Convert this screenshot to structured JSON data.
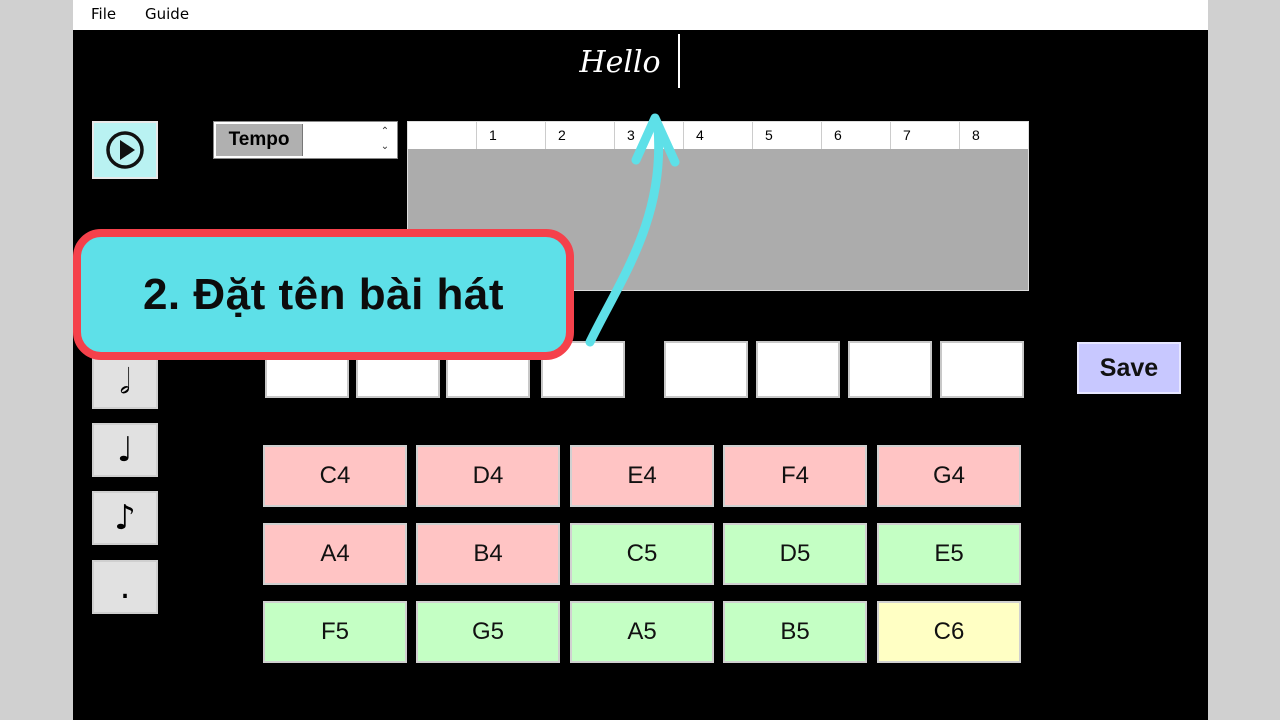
{
  "menu": {
    "file": "File",
    "guide": "Guide"
  },
  "song": {
    "title": "Hello"
  },
  "tempo": {
    "label": "Tempo",
    "value": ""
  },
  "grid": {
    "columns": [
      "1",
      "2",
      "3",
      "4",
      "5",
      "6",
      "7",
      "8"
    ]
  },
  "durations": [
    {
      "icon": "half-note-icon",
      "glyph": "𝅗𝅥"
    },
    {
      "icon": "quarter-note-icon",
      "glyph": "♩"
    },
    {
      "icon": "eighth-note-icon",
      "glyph": "♪"
    },
    {
      "icon": "dot-icon",
      "glyph": "."
    }
  ],
  "save_label": "Save",
  "notes": [
    {
      "label": "C4",
      "color": "#ffc4c4"
    },
    {
      "label": "D4",
      "color": "#ffc4c4"
    },
    {
      "label": "E4",
      "color": "#ffc4c4"
    },
    {
      "label": "F4",
      "color": "#ffc4c4"
    },
    {
      "label": "G4",
      "color": "#ffc4c4"
    },
    {
      "label": "A4",
      "color": "#ffc4c4"
    },
    {
      "label": "B4",
      "color": "#ffc4c4"
    },
    {
      "label": "C5",
      "color": "#c4ffc4"
    },
    {
      "label": "D5",
      "color": "#c4ffc4"
    },
    {
      "label": "E5",
      "color": "#c4ffc4"
    },
    {
      "label": "F5",
      "color": "#c4ffc4"
    },
    {
      "label": "G5",
      "color": "#c4ffc4"
    },
    {
      "label": "A5",
      "color": "#c4ffc4"
    },
    {
      "label": "B5",
      "color": "#c4ffc4"
    },
    {
      "label": "C6",
      "color": "#ffffc4"
    }
  ],
  "callout": {
    "text": "2. Đặt tên bài hát"
  },
  "colors": {
    "play_button": "#b9f2f2",
    "save_button": "#c8c8ff",
    "callout_fill": "#5ee0e8",
    "callout_border": "#f5414b",
    "arrow": "#5ee0e8"
  }
}
